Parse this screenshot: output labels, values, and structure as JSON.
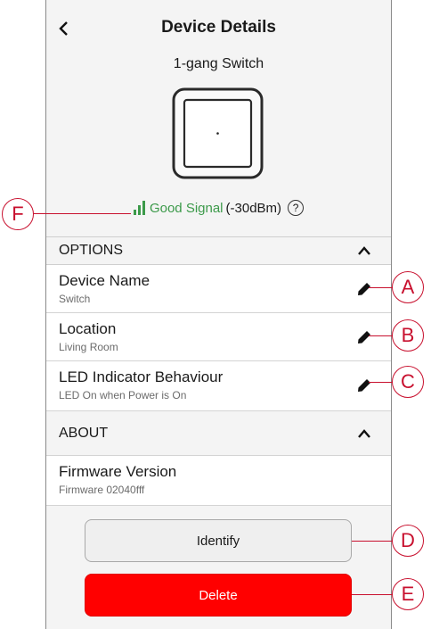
{
  "header": {
    "title": "Device Details",
    "subtitle": "1-gang Switch"
  },
  "signal": {
    "quality": "Good Signal",
    "strength": "(-30dBm)",
    "help": "?"
  },
  "options": {
    "header": "OPTIONS",
    "items": [
      {
        "label": "Device Name",
        "value": "Switch"
      },
      {
        "label": "Location",
        "value": "Living Room"
      },
      {
        "label": "LED Indicator Behaviour",
        "value": "LED On when Power is On"
      }
    ]
  },
  "about": {
    "header": "ABOUT",
    "firmware_label": "Firmware Version",
    "firmware_value": "Firmware 02040fff"
  },
  "buttons": {
    "identify": "Identify",
    "delete": "Delete"
  },
  "callouts": {
    "a": "A",
    "b": "B",
    "c": "C",
    "d": "D",
    "e": "E",
    "f": "F"
  },
  "colors": {
    "signal_good": "#3c9a4a",
    "delete_button": "#ff0000",
    "callout": "#c8102e"
  }
}
